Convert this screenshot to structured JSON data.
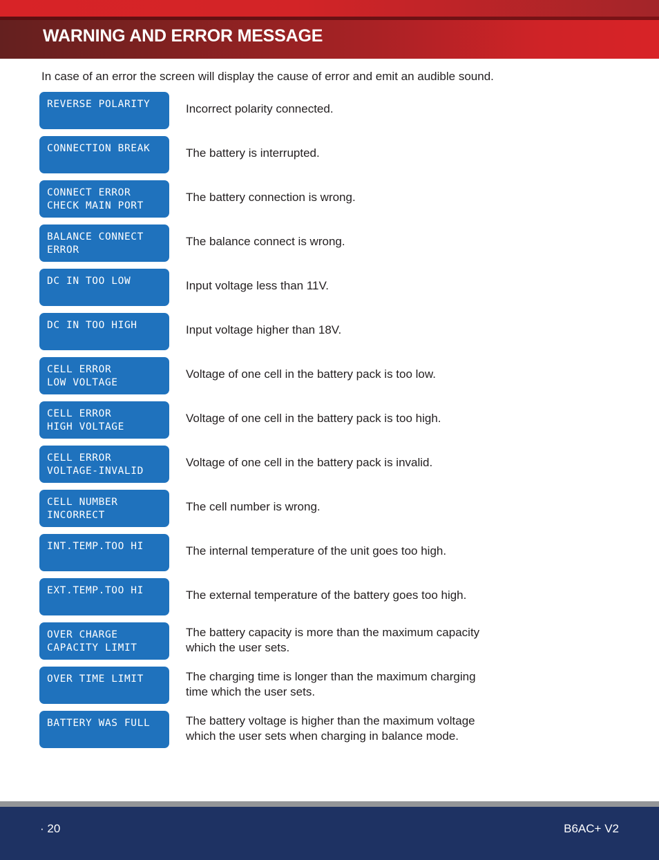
{
  "page": {
    "header_title": "WARNING AND ERROR MESSAGE",
    "intro": "In case of an error the screen will display the cause of error and emit an audible sound.",
    "colors": {
      "header_red_dark": "#64201f",
      "header_red_bright": "#d82327",
      "lcd_blue": "#1f72bd",
      "footer_navy": "#1e3263",
      "footer_rule_gray": "#939598",
      "body_text": "#231f20"
    }
  },
  "errors": [
    {
      "code_lines": [
        "REVERSE POLARITY"
      ],
      "desc_lines": [
        "Incorrect polarity connected."
      ]
    },
    {
      "code_lines": [
        "CONNECTION BREAK"
      ],
      "desc_lines": [
        "The battery is interrupted."
      ]
    },
    {
      "code_lines": [
        "CONNECT ERROR",
        "CHECK MAIN PORT"
      ],
      "desc_lines": [
        "The battery connection is wrong."
      ]
    },
    {
      "code_lines": [
        "BALANCE CONNECT",
        "ERROR"
      ],
      "desc_lines": [
        "The balance connect is wrong."
      ]
    },
    {
      "code_lines": [
        "DC IN TOO LOW"
      ],
      "desc_lines": [
        "Input voltage less than 11V."
      ]
    },
    {
      "code_lines": [
        "DC IN TOO HIGH"
      ],
      "desc_lines": [
        "Input voltage higher than 18V."
      ]
    },
    {
      "code_lines": [
        "CELL ERROR",
        "LOW VOLTAGE"
      ],
      "desc_lines": [
        "Voltage of one cell in the battery pack is too low."
      ]
    },
    {
      "code_lines": [
        "CELL ERROR",
        "HIGH VOLTAGE"
      ],
      "desc_lines": [
        "Voltage of one cell in the battery pack is too high."
      ]
    },
    {
      "code_lines": [
        "CELL ERROR",
        "VOLTAGE-INVALID"
      ],
      "desc_lines": [
        "Voltage of one cell in the battery pack is invalid."
      ]
    },
    {
      "code_lines": [
        "CELL NUMBER",
        "INCORRECT"
      ],
      "desc_lines": [
        "The cell number is wrong."
      ]
    },
    {
      "code_lines": [
        "INT.TEMP.TOO HI"
      ],
      "desc_lines": [
        "The internal temperature of the unit goes too high."
      ]
    },
    {
      "code_lines": [
        "EXT.TEMP.TOO HI"
      ],
      "desc_lines": [
        "The external temperature of the battery goes too high."
      ]
    },
    {
      "code_lines": [
        "OVER CHARGE",
        "CAPACITY LIMIT"
      ],
      "desc_lines": [
        "The battery capacity is more than the maximum capacity",
        "which the  user sets."
      ]
    },
    {
      "code_lines": [
        "OVER TIME LIMIT"
      ],
      "desc_lines": [
        "The charging time is longer than the maximum charging",
        "time which the  user sets."
      ]
    },
    {
      "code_lines": [
        "BATTERY WAS FULL"
      ],
      "desc_lines": [
        "The battery voltage is higher than the maximum voltage",
        "which the  user sets  when charging in balance mode."
      ]
    }
  ],
  "footer": {
    "page_number": "·  20",
    "model": "B6AC+ V2"
  }
}
